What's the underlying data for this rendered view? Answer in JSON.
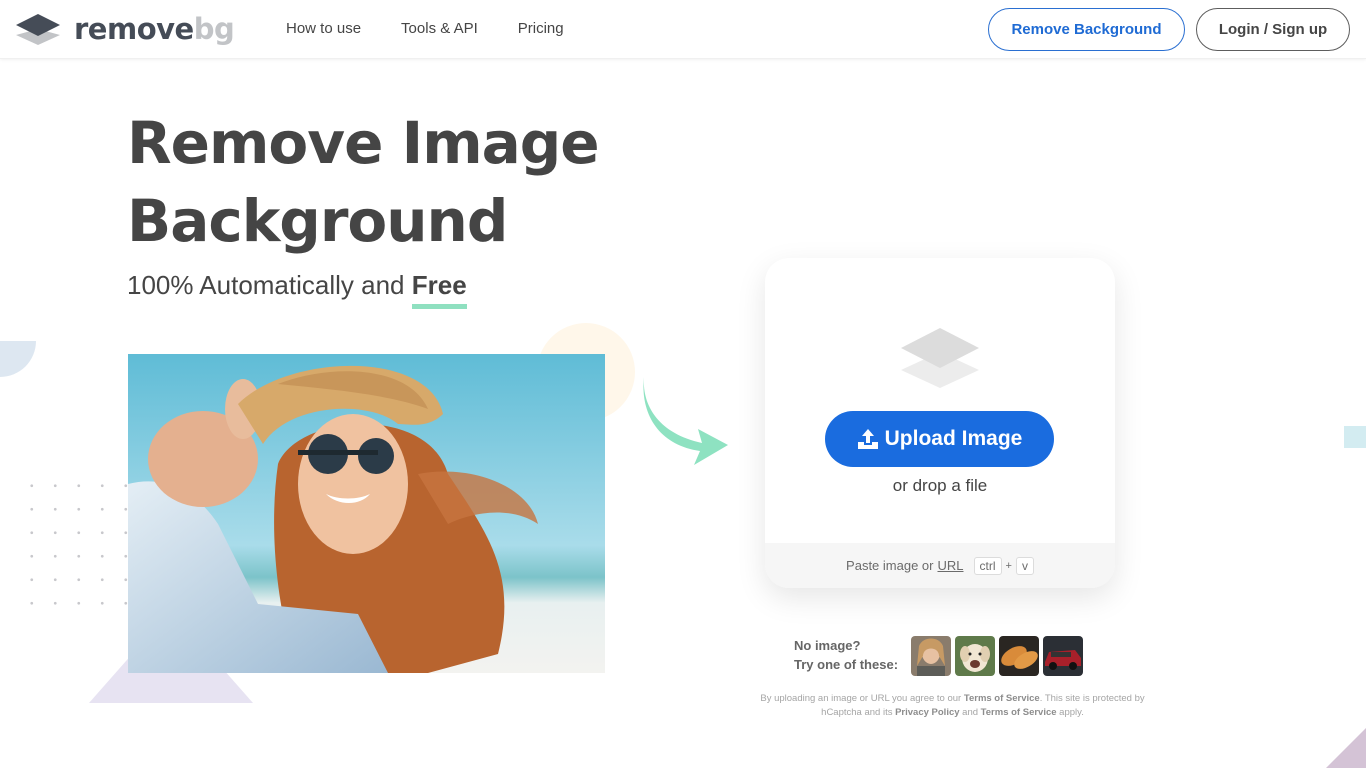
{
  "header": {
    "logo_main": "remove",
    "logo_accent": "bg",
    "nav": [
      {
        "label": "How to use"
      },
      {
        "label": "Tools & API"
      },
      {
        "label": "Pricing"
      }
    ],
    "remove_background_label": "Remove Background",
    "login_label": "Login / Sign up"
  },
  "hero": {
    "title_line1": "Remove Image",
    "title_line2": "Background",
    "subtitle_prefix": "100% Automatically and ",
    "subtitle_highlight": "Free",
    "image_alt": "Woman in straw hat and sunglasses at the beach"
  },
  "upload": {
    "button_label": "Upload Image",
    "drop_text": "or drop a file",
    "paste_text": "Paste image or",
    "url_link": "URL",
    "key1": "ctrl",
    "plus": "+",
    "key2": "v"
  },
  "samples": {
    "line1": "No image?",
    "line2": "Try one of these:",
    "items": [
      {
        "name": "woman"
      },
      {
        "name": "dog"
      },
      {
        "name": "bread"
      },
      {
        "name": "car"
      }
    ]
  },
  "legal": {
    "t1": "By uploading an image or URL you agree to our ",
    "tos1": "Terms of Service",
    "t2": ". This site is protected by hCaptcha and its ",
    "privacy": "Privacy Policy",
    "t3": " and ",
    "tos2": "Terms of Service",
    "t4": " apply."
  },
  "colors": {
    "brand_blue": "#1a6cdf",
    "text_dark": "#454545",
    "accent_green": "#8fe0c0"
  }
}
